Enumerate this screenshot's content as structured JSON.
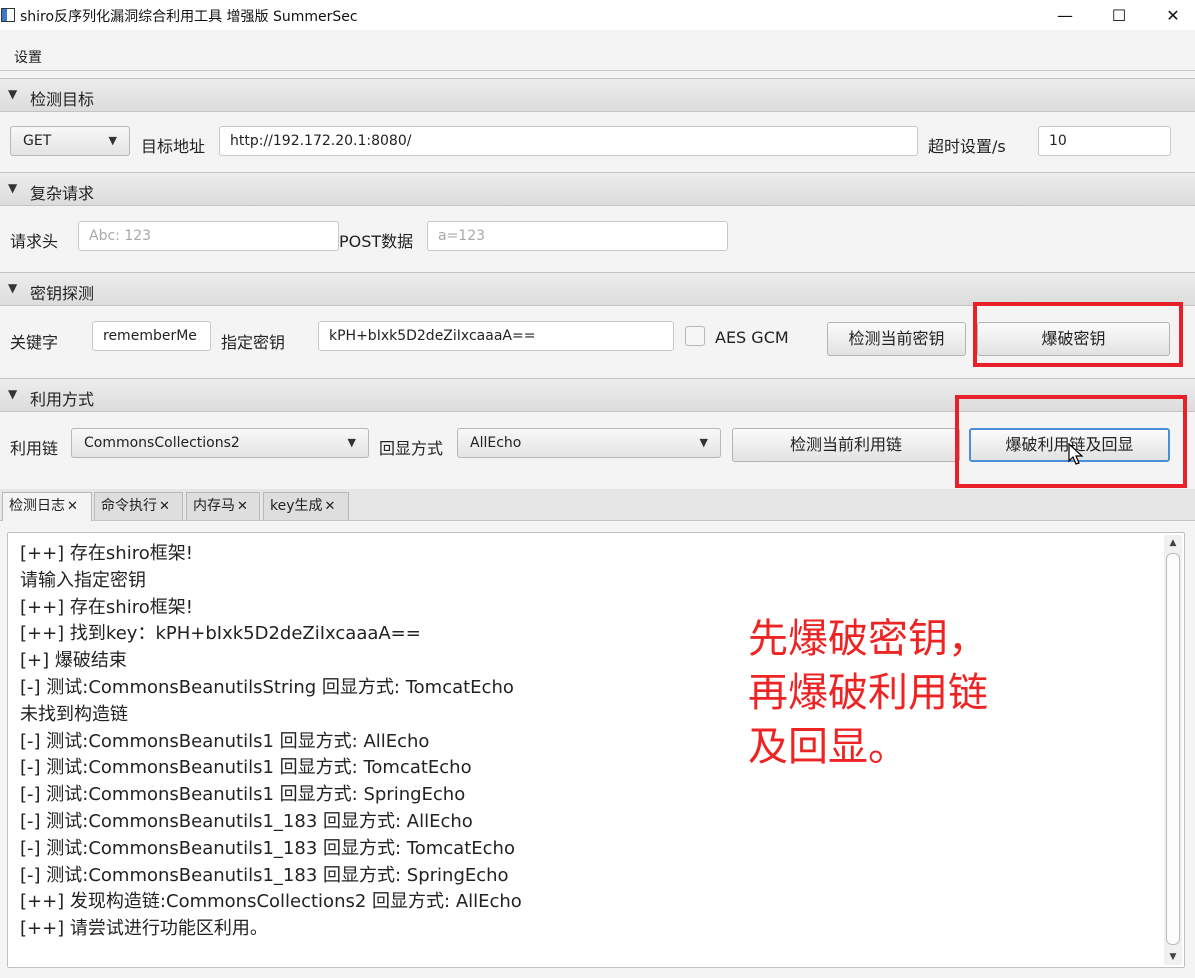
{
  "window": {
    "title": "shiro反序列化漏洞综合利用工具 增强版 SummerSec",
    "minimize_glyph": "—",
    "maximize_glyph": "☐",
    "close_glyph": "✕"
  },
  "menu": {
    "settings": "设置"
  },
  "target_section": {
    "header": "检测目标",
    "method": "GET",
    "url_label": "目标地址",
    "url_value": "http://192.172.20.1:8080/",
    "timeout_label": "超时设置/s",
    "timeout_value": "10"
  },
  "complex_section": {
    "header": "复杂请求",
    "headers_label": "请求头",
    "headers_placeholder": "Abc: 123",
    "post_label": "POST数据",
    "post_placeholder": "a=123"
  },
  "key_section": {
    "header": "密钥探测",
    "keyword_label": "关键字",
    "keyword_value": "rememberMe",
    "key_label": "指定密钥",
    "key_value": "kPH+bIxk5D2deZiIxcaaaA==",
    "aes_gcm_label": "AES GCM",
    "aes_gcm_checked": false,
    "check_key_button": "检测当前密钥",
    "brute_key_button": "爆破密钥"
  },
  "exploit_section": {
    "header": "利用方式",
    "chain_label": "利用链",
    "chain_value": "CommonsCollections2",
    "echo_label": "回显方式",
    "echo_value": "AllEcho",
    "check_chain_button": "检测当前利用链",
    "brute_chain_button": "爆破利用链及回显"
  },
  "tabs": [
    {
      "label": "检测日志",
      "active": true
    },
    {
      "label": "命令执行",
      "active": false
    },
    {
      "label": "内存马",
      "active": false
    },
    {
      "label": "key生成",
      "active": false
    }
  ],
  "tab_close_glyph": "✕",
  "log": [
    "[++] 存在shiro框架!",
    "请输入指定密钥",
    "[++] 存在shiro框架!",
    "[++] 找到key：kPH+bIxk5D2deZiIxcaaaA==",
    "[+] 爆破结束",
    "[-] 测试:CommonsBeanutilsString  回显方式: TomcatEcho",
    "未找到构造链",
    "[-] 测试:CommonsBeanutils1  回显方式: AllEcho",
    "[-] 测试:CommonsBeanutils1  回显方式: TomcatEcho",
    "[-] 测试:CommonsBeanutils1  回显方式: SpringEcho",
    "[-] 测试:CommonsBeanutils1_183  回显方式: AllEcho",
    "[-] 测试:CommonsBeanutils1_183  回显方式: TomcatEcho",
    "[-] 测试:CommonsBeanutils1_183  回显方式: SpringEcho",
    "[++] 发现构造链:CommonsCollections2  回显方式: AllEcho",
    "[++] 请尝试进行功能区利用。"
  ],
  "annotation": {
    "line1": "先爆破密钥，",
    "line2": "再爆破利用链",
    "line3": "及回显。",
    "color": "#ee2424"
  },
  "highlight_color": "#e8202a",
  "glyphs": {
    "collapse_arrow": "▼",
    "dropdown_caret": "▼",
    "scroll_up": "▲",
    "scroll_down": "▼"
  }
}
